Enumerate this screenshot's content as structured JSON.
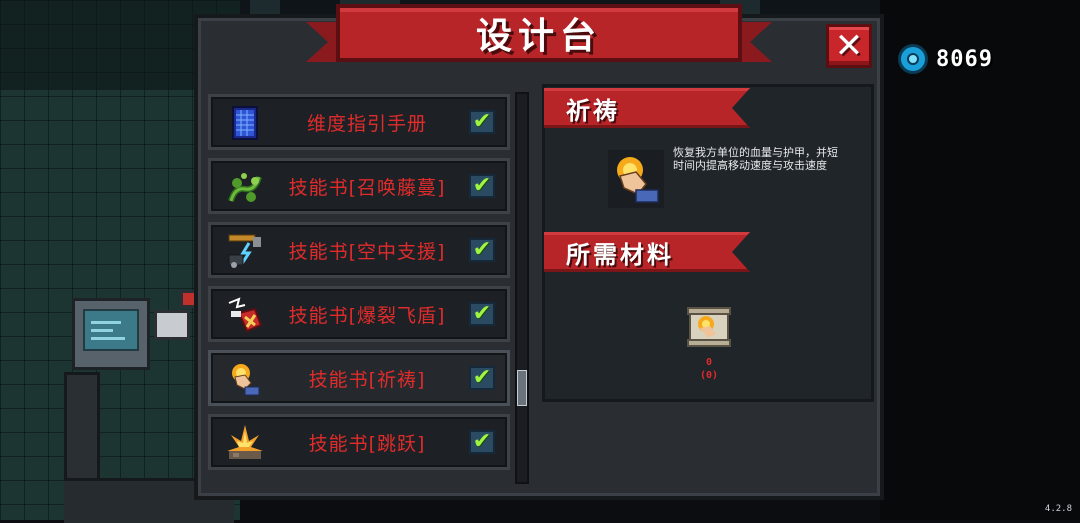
{
  "currency": {
    "amount": "8069",
    "icon": "gem-icon",
    "color": "#1aa0d8"
  },
  "version": "4.2.8",
  "panel": {
    "title": "设计台",
    "close_label": "✕"
  },
  "recipes": [
    {
      "label": "维度指引手册",
      "icon": "dimension-manual-icon",
      "checked": true
    },
    {
      "label": "技能书[召唤藤蔓]",
      "icon": "vine-summon-icon",
      "checked": true
    },
    {
      "label": "技能书[空中支援]",
      "icon": "air-support-icon",
      "checked": true
    },
    {
      "label": "技能书[爆裂飞盾]",
      "icon": "burst-shield-icon",
      "checked": true
    },
    {
      "label": "技能书[祈祷]",
      "icon": "prayer-hand-icon",
      "checked": true,
      "selected": true
    },
    {
      "label": "技能书[跳跃]",
      "icon": "jump-burst-icon",
      "checked": true
    }
  ],
  "check_mark": "✔",
  "detail": {
    "name": "祈祷",
    "description": "恢复我方单位的血量与护甲，并短时间内提高移动速度与攻击速度",
    "materials_title": "所需材料",
    "material": {
      "icon": "prayer-scroll-icon",
      "need": "0",
      "have": "(0)"
    }
  },
  "colors": {
    "accent_red": "#b82529",
    "item_text": "#e02b2b",
    "check_green": "#9ef542"
  }
}
